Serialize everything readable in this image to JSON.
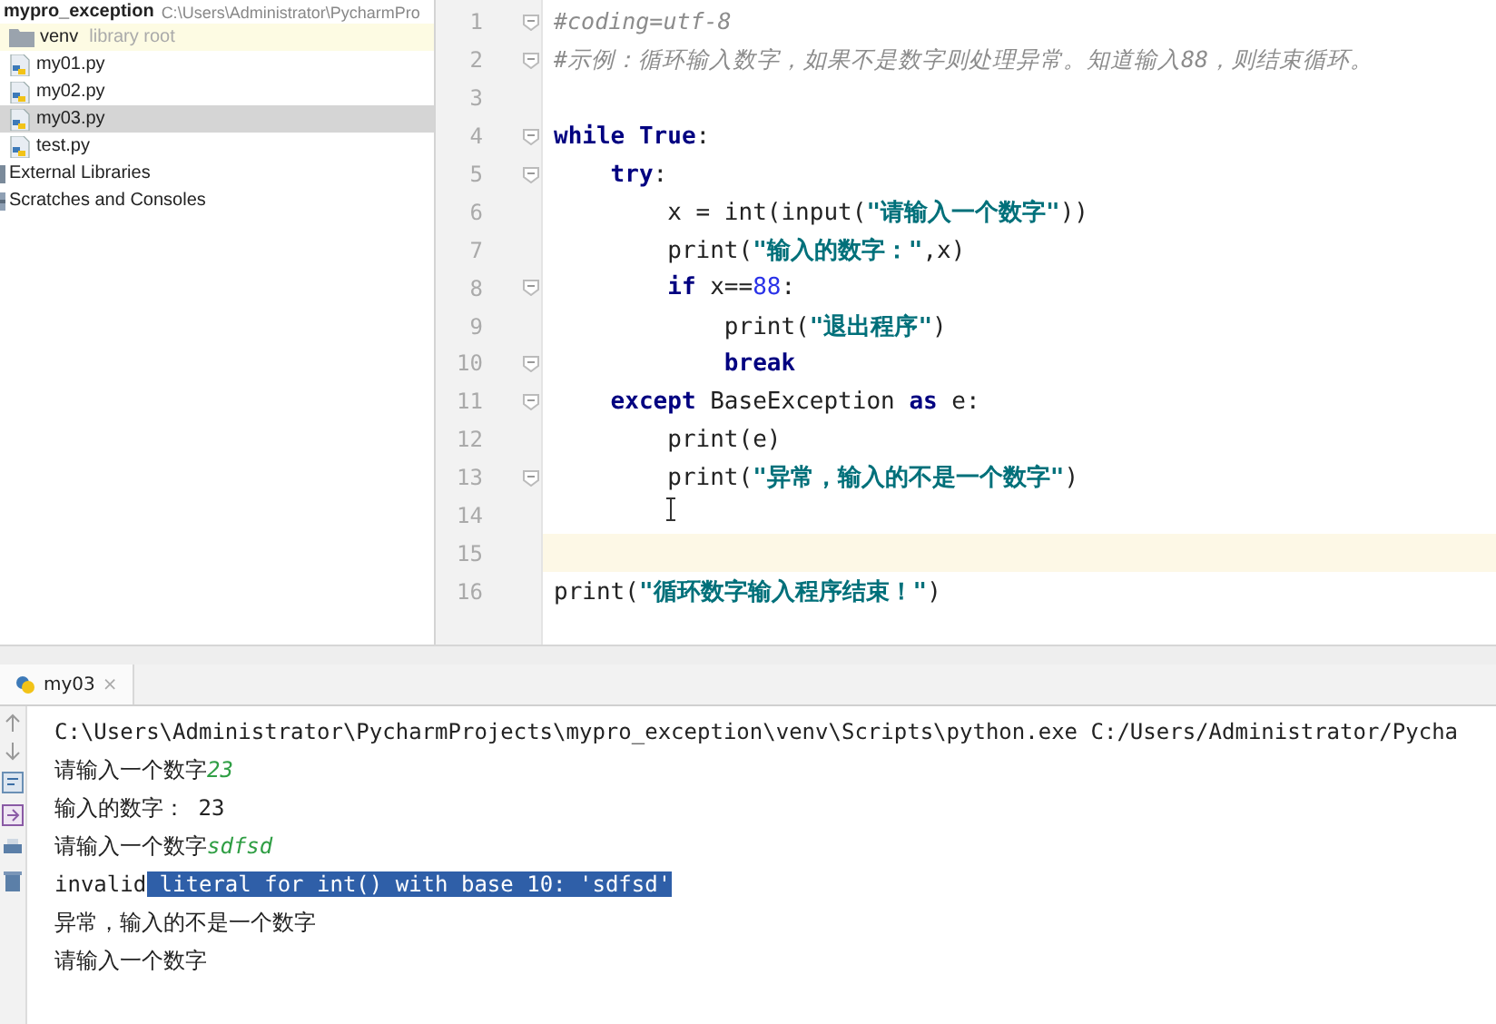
{
  "project": {
    "name": "mypro_exception",
    "path": "C:\\Users\\Administrator\\PycharmPro",
    "children": [
      {
        "kind": "folder",
        "label": "venv",
        "note": "library root",
        "selected": false,
        "highlighted": true
      },
      {
        "kind": "pyfile",
        "label": "my01.py",
        "selected": false,
        "highlighted": false
      },
      {
        "kind": "pyfile",
        "label": "my02.py",
        "selected": false,
        "highlighted": false
      },
      {
        "kind": "pyfile",
        "label": "my03.py",
        "selected": true,
        "highlighted": false
      },
      {
        "kind": "pyfile",
        "label": "test.py",
        "selected": false,
        "highlighted": false
      }
    ]
  },
  "tree_extra": [
    {
      "kind": "library",
      "label": "External Libraries"
    },
    {
      "kind": "scratch",
      "label": "Scratches and Consoles"
    }
  ],
  "editor": {
    "lines": [
      {
        "number": "1",
        "fold": true,
        "current": false,
        "tokens": [
          {
            "kind": "comment",
            "text": "#coding=utf-8"
          }
        ]
      },
      {
        "number": "2",
        "fold": true,
        "current": false,
        "tokens": [
          {
            "kind": "comment",
            "text": "#示例：循环输入数字，如果不是数字则处理异常。知道输入88，则结束循环。"
          }
        ]
      },
      {
        "number": "3",
        "fold": false,
        "current": false
      },
      {
        "number": "4",
        "fold": true,
        "current": false,
        "tokens": [
          {
            "kind": "kw",
            "text": "while True"
          },
          {
            "kind": "plain",
            "text": ":"
          }
        ]
      },
      {
        "number": "5",
        "fold": true,
        "current": false,
        "tokens": [
          {
            "kind": "kw",
            "text": "    try"
          },
          {
            "kind": "plain",
            "text": ":"
          }
        ]
      },
      {
        "number": "6",
        "fold": false,
        "current": false,
        "tokens": [
          {
            "kind": "plain",
            "text": "        x = int(input("
          },
          {
            "kind": "str",
            "text": "\"请输入一个数字\""
          },
          {
            "kind": "plain",
            "text": "))"
          }
        ]
      },
      {
        "number": "7",
        "fold": false,
        "current": false,
        "tokens": [
          {
            "kind": "plain",
            "text": "        print("
          },
          {
            "kind": "str",
            "text": "\"输入的数字：\""
          },
          {
            "kind": "plain",
            "text": ",x)"
          }
        ]
      },
      {
        "number": "8",
        "fold": true,
        "current": false,
        "tokens": [
          {
            "kind": "kw",
            "text": "        if"
          },
          {
            "kind": "plain",
            "text": " x=="
          },
          {
            "kind": "num",
            "text": "88"
          },
          {
            "kind": "plain",
            "text": ":"
          }
        ]
      },
      {
        "number": "9",
        "fold": false,
        "current": false,
        "tokens": [
          {
            "kind": "plain",
            "text": "            print("
          },
          {
            "kind": "str",
            "text": "\"退出程序\""
          },
          {
            "kind": "plain",
            "text": ")"
          }
        ]
      },
      {
        "number": "10",
        "fold": true,
        "current": false,
        "tokens": [
          {
            "kind": "kw",
            "text": "            break"
          }
        ]
      },
      {
        "number": "11",
        "fold": true,
        "current": false,
        "tokens": [
          {
            "kind": "kw",
            "text": "    except"
          },
          {
            "kind": "plain",
            "text": " BaseException "
          },
          {
            "kind": "kw",
            "text": "as"
          },
          {
            "kind": "plain",
            "text": " e:"
          }
        ]
      },
      {
        "number": "12",
        "fold": false,
        "current": false,
        "tokens": [
          {
            "kind": "plain",
            "text": "        print(e)"
          }
        ]
      },
      {
        "number": "13",
        "fold": true,
        "current": false,
        "tokens": [
          {
            "kind": "plain",
            "text": "        print("
          },
          {
            "kind": "str",
            "text": "\"异常，输入的不是一个数字\""
          },
          {
            "kind": "plain",
            "text": ")"
          }
        ]
      },
      {
        "number": "14",
        "fold": false,
        "current": false
      },
      {
        "number": "15",
        "fold": false,
        "current": true
      },
      {
        "number": "16",
        "fold": false,
        "current": false,
        "tokens": [
          {
            "kind": "plain",
            "text": "print("
          },
          {
            "kind": "str",
            "text": "\"循环数字输入程序结束！\""
          },
          {
            "kind": "plain",
            "text": ")"
          }
        ]
      }
    ]
  },
  "run_tab": {
    "label": "my03",
    "close": "×",
    "selected": true
  },
  "console": [
    [
      {
        "kind": "plain",
        "text": "C:\\Users\\Administrator\\PycharmProjects\\mypro_exception\\venv\\Scripts\\python.exe C:/Users/Administrator/Pycha"
      }
    ],
    [
      {
        "kind": "plain",
        "text": "请输入一个数字"
      },
      {
        "kind": "input",
        "text": "23"
      }
    ],
    [
      {
        "kind": "plain",
        "text": "输入的数字： 23"
      }
    ],
    [
      {
        "kind": "plain",
        "text": "请输入一个数字"
      },
      {
        "kind": "input",
        "text": "sdfsd"
      }
    ],
    [
      {
        "kind": "plain",
        "text": "invalid"
      },
      {
        "kind": "selected",
        "text": " literal for int() with base 10: 'sdfsd'"
      }
    ],
    [
      {
        "kind": "plain",
        "text": "异常，输入的不是一个数字"
      }
    ],
    [
      {
        "kind": "plain",
        "text": "请输入一个数字"
      }
    ]
  ]
}
